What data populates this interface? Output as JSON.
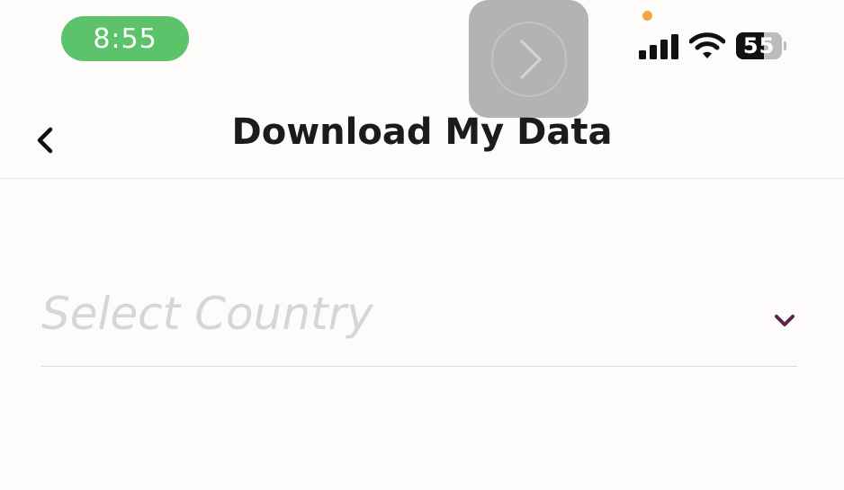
{
  "status_bar": {
    "time": "8:55",
    "battery": "55"
  },
  "header": {
    "title": "Download My Data"
  },
  "form": {
    "country_placeholder": "Select Country"
  },
  "colors": {
    "time_pill": "#5dc36b",
    "accent_chevron": "#5a2550",
    "recording_dot": "#f2a742"
  }
}
